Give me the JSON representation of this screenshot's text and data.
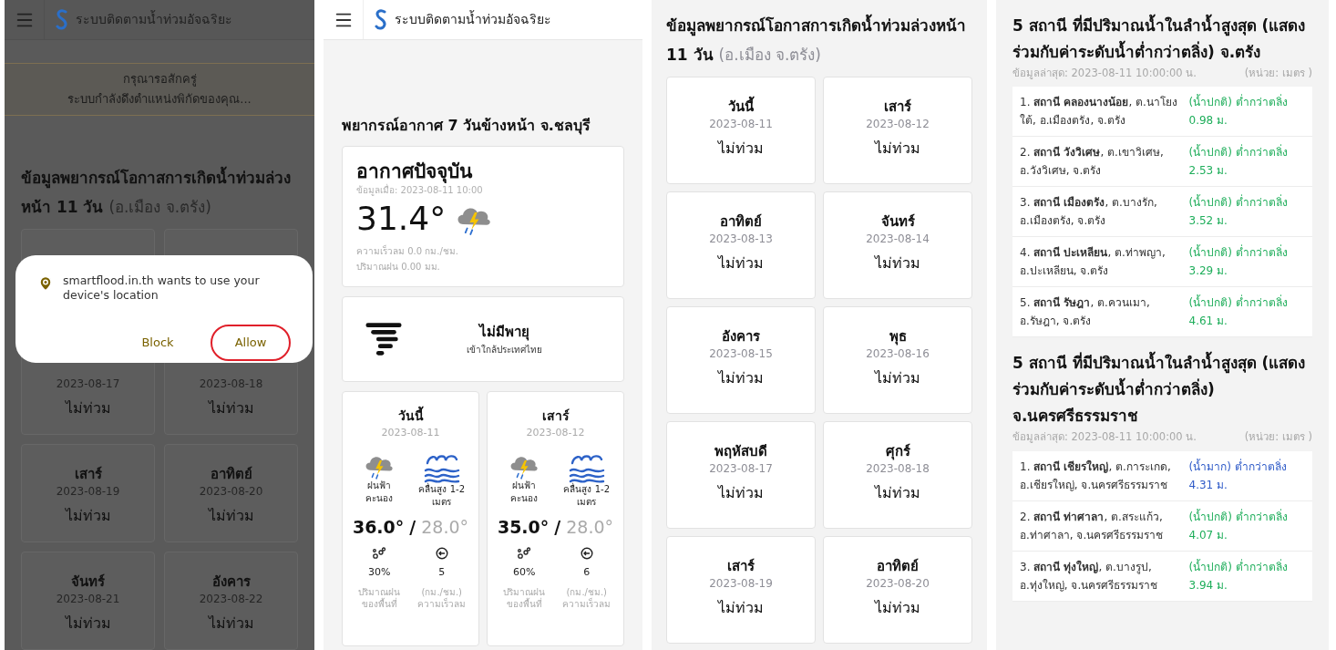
{
  "location_prompt_screen": {
    "app_title": "ระบบติดตามน้ำท่วมอัจฉริยะ",
    "banner": [
      "กรุณารอสักครู่",
      "ระบบกำลังดึงตำแหน่งพิกัดของคุณ..."
    ],
    "heading": "ข้อมูลพยากรณ์โอกาสการเกิดน้ำท่วมล่วงหน้า 11 วัน",
    "heading_location": "(อ.เมือง จ.ตรัง)",
    "cards": [
      {
        "kind": "covered"
      },
      {
        "kind": "covered"
      },
      {
        "kind": "partial",
        "date": "2023-08-17",
        "status": "ไม่ท่วม"
      },
      {
        "kind": "partial",
        "date": "2023-08-18",
        "status": "ไม่ท่วม"
      },
      {
        "day": "เสาร์",
        "date": "2023-08-19",
        "status": "ไม่ท่วม"
      },
      {
        "day": "อาทิตย์",
        "date": "2023-08-20",
        "status": "ไม่ท่วม"
      },
      {
        "day": "จันทร์",
        "date": "2023-08-21",
        "status": "ไม่ท่วม"
      },
      {
        "day": "อังคาร",
        "date": "2023-08-22",
        "status": "ไม่ท่วม"
      }
    ],
    "dialog": {
      "message": "smartflood.in.th wants to use your device's location",
      "buttons": [
        {
          "label": "Block",
          "highlighted": false
        },
        {
          "label": "Allow",
          "highlighted": true
        }
      ]
    }
  },
  "weather_screen": {
    "app_title": "ระบบติดตามน้ำท่วมอัจฉริยะ",
    "heading": "พยากรณ์อากาศ 7 วันข้างหน้า จ.ชลบุรี",
    "current": {
      "title": "อากาศปัจจุบัน",
      "updated": "ข้อมูลเมื่อ: 2023-08-11 10:00",
      "temperature": "31.4°",
      "wind": "ความเร็วลม 0.0 กม./ชม.",
      "rain": "ปริมาณฝน 0.00 มม."
    },
    "storm": {
      "title": "ไม่มีพายุ",
      "subtitle": "เข้าใกล้ประเทศไทย"
    },
    "days": [
      {
        "day": "วันนี้",
        "date": "2023-08-11",
        "condition": [
          "ฝนฟ้า",
          "คะนอง"
        ],
        "wave": [
          "คลื่นสูง 1-2",
          "เมตร"
        ],
        "high": "36.0°",
        "separator": "/",
        "low": "28.0°",
        "rain_chance": "30%",
        "rain_label": [
          "ปริมาณฝน",
          "ของพื้นที่"
        ],
        "wind_speed": "5",
        "wind_label": [
          "(กม./ชม.)",
          "ความเร็วลม"
        ]
      },
      {
        "day": "เสาร์",
        "date": "2023-08-12",
        "condition": [
          "ฝนฟ้า",
          "คะนอง"
        ],
        "wave": [
          "คลื่นสูง 1-2",
          "เมตร"
        ],
        "high": "35.0°",
        "separator": "/",
        "low": "28.0°",
        "rain_chance": "60%",
        "rain_label": [
          "ปริมาณฝน",
          "ของพื้นที่"
        ],
        "wind_speed": "6",
        "wind_label": [
          "(กม./ชม.)",
          "ความเร็วลม"
        ]
      }
    ]
  },
  "flood_forecast_screen": {
    "heading": "ข้อมูลพยากรณ์โอกาสการเกิดน้ำท่วมล่วงหน้า 11 วัน",
    "heading_location": "(อ.เมือง จ.ตรัง)",
    "cards": [
      {
        "day": "วันนี้",
        "date": "2023-08-11",
        "status": "ไม่ท่วม"
      },
      {
        "day": "เสาร์",
        "date": "2023-08-12",
        "status": "ไม่ท่วม"
      },
      {
        "day": "อาทิตย์",
        "date": "2023-08-13",
        "status": "ไม่ท่วม"
      },
      {
        "day": "จันทร์",
        "date": "2023-08-14",
        "status": "ไม่ท่วม"
      },
      {
        "day": "อังคาร",
        "date": "2023-08-15",
        "status": "ไม่ท่วม"
      },
      {
        "day": "พุธ",
        "date": "2023-08-16",
        "status": "ไม่ท่วม"
      },
      {
        "day": "พฤหัสบดี",
        "date": "2023-08-17",
        "status": "ไม่ท่วม"
      },
      {
        "day": "ศุกร์",
        "date": "2023-08-18",
        "status": "ไม่ท่วม"
      },
      {
        "day": "เสาร์",
        "date": "2023-08-19",
        "status": "ไม่ท่วม"
      },
      {
        "day": "อาทิตย์",
        "date": "2023-08-20",
        "status": "ไม่ท่วม"
      }
    ]
  },
  "station_screen": {
    "sections": [
      {
        "title": "5 สถานี ที่มีปริมาณน้ำในลำน้ำสูงสุด (แสดงร่วมกับค่าระดับน้ำต่ำกว่าตลิ่ง) จ.ตรัง",
        "updated": "ข้อมูลล่าสุด: 2023-08-11 10:00:00 น.",
        "unit": "(หน่วย: เมตร )",
        "stations": [
          {
            "name": "1. **สถานี คลองนางน้อย**, ต.นาโยงใต้, อ.เมืองตรัง, จ.ตรัง",
            "status": "(น้ำปกติ) ต่ำกว่าตลิ่ง 0.98 ม.",
            "kind": "normal"
          },
          {
            "name": "2. **สถานี วังวิเศษ**, ต.เขาวิเศษ, อ.วังวิเศษ, จ.ตรัง",
            "status": "(น้ำปกติ) ต่ำกว่าตลิ่ง 2.53 ม.",
            "kind": "normal"
          },
          {
            "name": "3. **สถานี เมืองตรัง**, ต.บางรัก, อ.เมืองตรัง, จ.ตรัง",
            "status": "(น้ำปกติ) ต่ำกว่าตลิ่ง 3.52 ม.",
            "kind": "normal"
          },
          {
            "name": "4. **สถานี ปะเหลียน**, ต.ท่าพญา, อ.ปะเหลียน, จ.ตรัง",
            "status": "(น้ำปกติ) ต่ำกว่าตลิ่ง 3.29 ม.",
            "kind": "normal"
          },
          {
            "name": "5. **สถานี รัษฎา**, ต.ควนเมา, อ.รัษฎา, จ.ตรัง",
            "status": "(น้ำปกติ) ต่ำกว่าตลิ่ง 4.61 ม.",
            "kind": "normal"
          }
        ]
      },
      {
        "title": "5 สถานี ที่มีปริมาณน้ำในลำน้ำสูงสุด (แสดงร่วมกับค่าระดับน้ำต่ำกว่าตลิ่ง) จ.นครศรีธรรมราช",
        "updated": "ข้อมูลล่าสุด: 2023-08-11 10:00:00 น.",
        "unit": "(หน่วย: เมตร )",
        "stations": [
          {
            "name": "1. **สถานี เชียรใหญ่**, ต.การะเกด, อ.เชียรใหญ่, จ.นครศรีธรรมราช",
            "status": "(น้ำมาก) ต่ำกว่าตลิ่ง 4.31 ม.",
            "kind": "high"
          },
          {
            "name": "2. **สถานี ท่าศาลา**, ต.สระแก้ว, อ.ท่าศาลา, จ.นครศรีธรรมราช",
            "status": "(น้ำปกติ) ต่ำกว่าตลิ่ง 4.07 ม.",
            "kind": "normal"
          },
          {
            "name": "3. **สถานี ทุ่งใหญ่**, ต.บางรูป, อ.ทุ่งใหญ่, จ.นครศรีธรรมราช",
            "status": "(น้ำปกติ) ต่ำกว่าตลิ่ง 3.94 ม.",
            "kind": "normal"
          }
        ]
      }
    ]
  }
}
